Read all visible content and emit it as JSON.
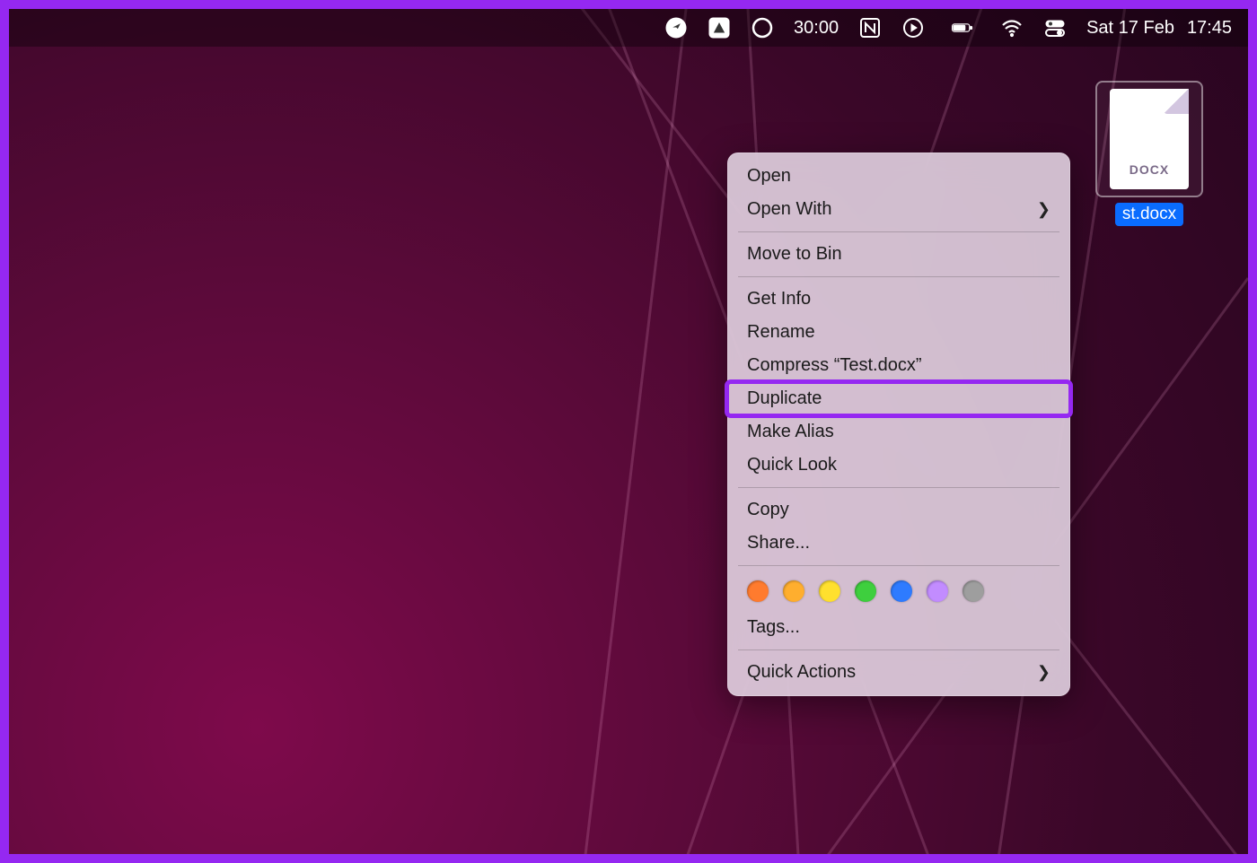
{
  "menubar": {
    "timer": "30:00",
    "date": "Sat 17 Feb",
    "time": "17:45"
  },
  "desktop_file": {
    "ext_label": "DOCX",
    "filename_visible": "st.docx"
  },
  "context_menu": {
    "open": "Open",
    "open_with": "Open With",
    "move_to_bin": "Move to Bin",
    "get_info": "Get Info",
    "rename": "Rename",
    "compress": "Compress “Test.docx”",
    "duplicate": "Duplicate",
    "make_alias": "Make Alias",
    "quick_look": "Quick Look",
    "copy": "Copy",
    "share": "Share...",
    "tags": "Tags...",
    "quick_actions": "Quick Actions"
  },
  "tag_colors": [
    "#ff7b2e",
    "#ffae2e",
    "#ffe02e",
    "#3ecf3e",
    "#2e7bff",
    "#c28cff",
    "#9e9e9e"
  ],
  "highlight_item": "duplicate"
}
